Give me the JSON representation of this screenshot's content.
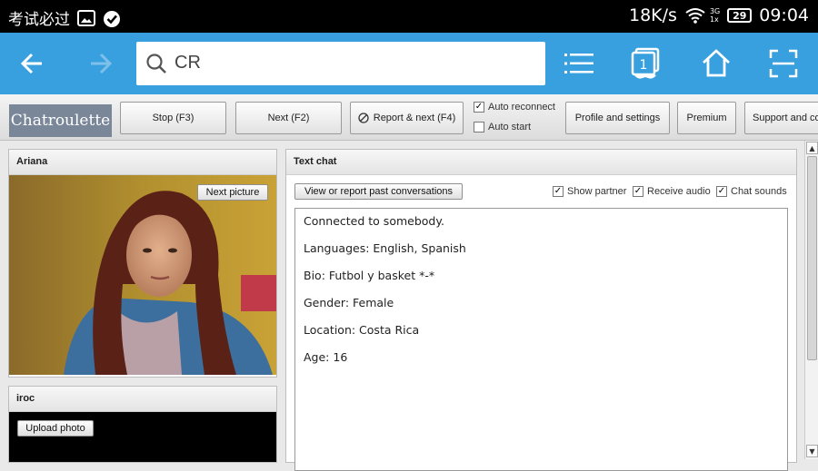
{
  "statusbar": {
    "app_text": "考试必过",
    "speed": "18K/s",
    "network": "3G",
    "network_sub": "1x",
    "battery": "29",
    "time": "09:04"
  },
  "browser": {
    "url": "CR",
    "accent": "#38a0df",
    "tab_count": "1"
  },
  "site": {
    "logo": "Chatroulette",
    "stop_label": "Stop (F3)",
    "next_label": "Next (F2)",
    "report_next_label": "Report & next (F4)",
    "auto_reconnect_label": "Auto reconnect",
    "auto_reconnect_checked": true,
    "auto_start_label": "Auto start",
    "auto_start_checked": false,
    "profile_label": "Profile and settings",
    "premium_label": "Premium",
    "support_label": "Support and co"
  },
  "partner": {
    "name": "Ariana",
    "next_picture_label": "Next picture"
  },
  "self": {
    "name": "iroc",
    "upload_label": "Upload photo"
  },
  "chat": {
    "title": "Text chat",
    "view_report_label": "View or report past conversations",
    "show_partner_label": "Show partner",
    "receive_audio_label": "Receive audio",
    "chat_sounds_label": "Chat sounds",
    "messages": [
      "Connected to somebody.",
      "Languages: English, Spanish",
      "Bio: Futbol y basket *-*",
      "Gender: Female",
      "Location: Costa Rica",
      "Age: 16"
    ]
  }
}
